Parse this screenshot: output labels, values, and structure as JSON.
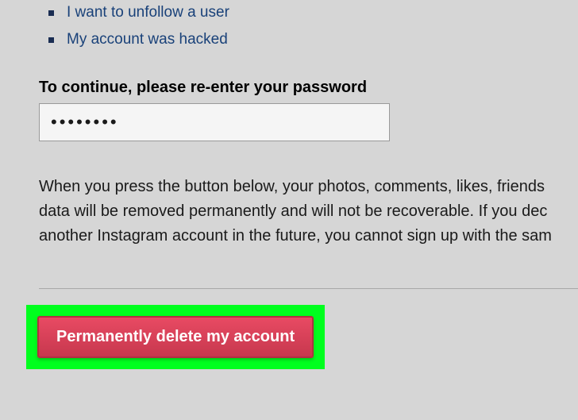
{
  "reasons_list": {
    "items": [
      {
        "label": "I want to unfollow a user"
      },
      {
        "label": "My account was hacked"
      }
    ]
  },
  "password_section": {
    "label": "To continue, please re-enter your password",
    "value": "••••••••"
  },
  "warning": {
    "line1": "When you press the button below, your photos, comments, likes, friends",
    "line2": "data will be removed permanently and will not be recoverable. If you dec",
    "line3": "another Instagram account in the future, you cannot sign up with the sam"
  },
  "actions": {
    "delete_label": "Permanently delete my account"
  }
}
